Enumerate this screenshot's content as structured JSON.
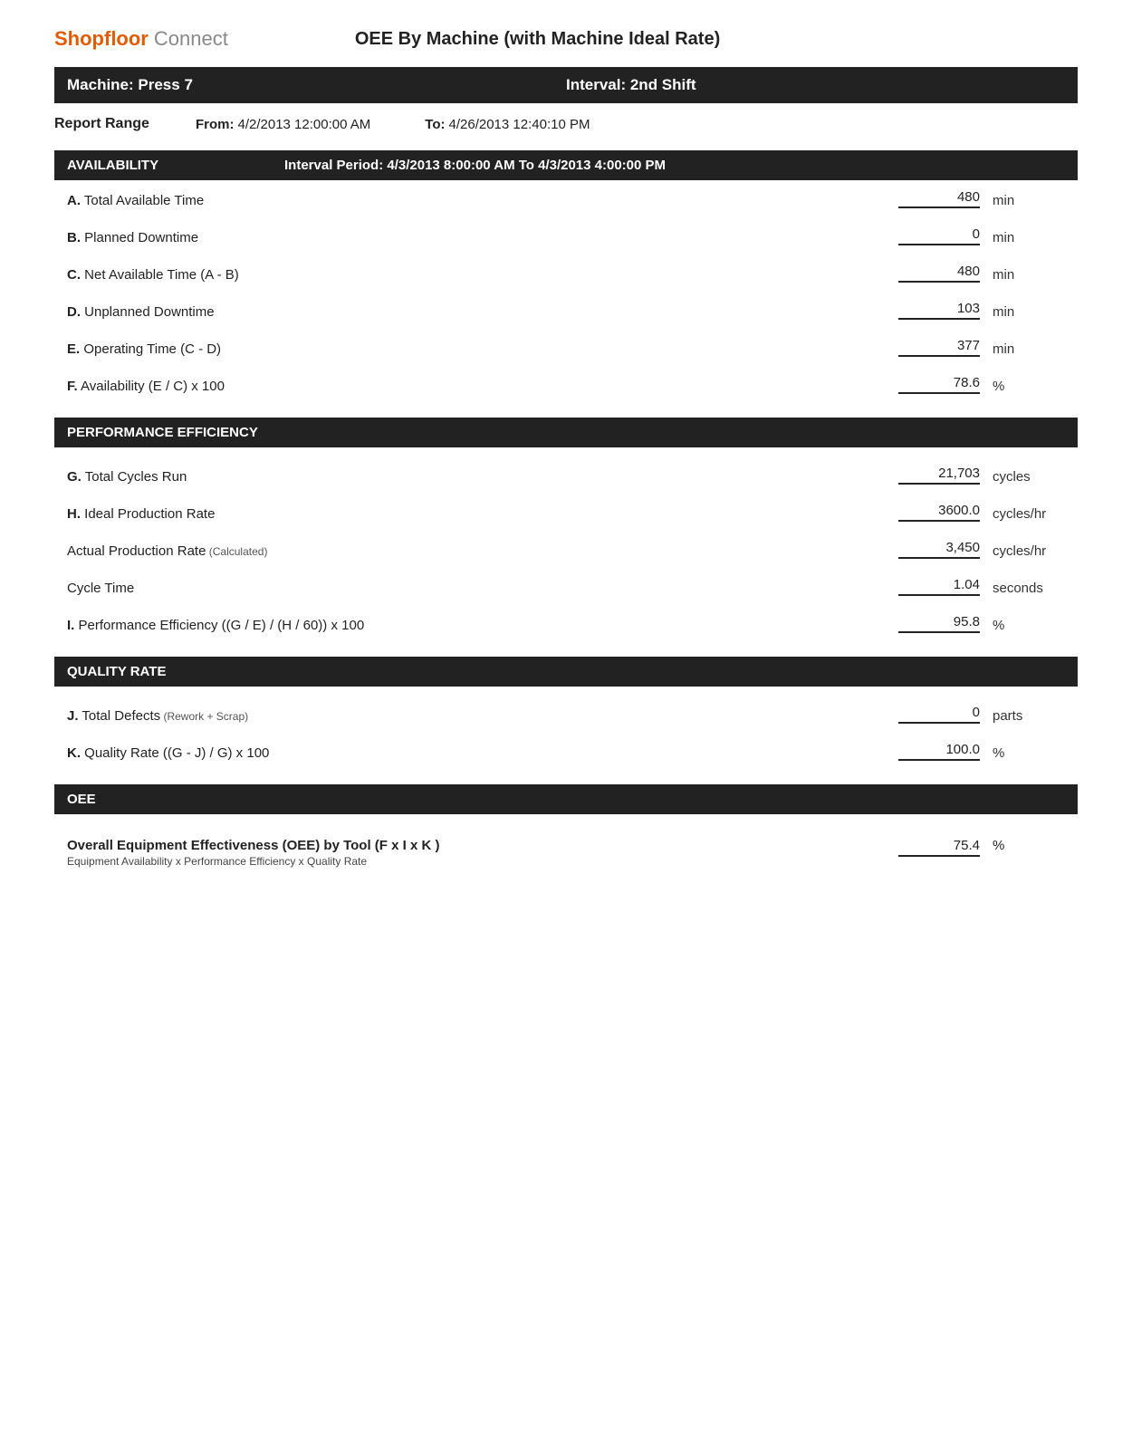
{
  "header": {
    "logo_shopfloor": "Shopfloor",
    "logo_connect": "Connect",
    "report_title": "OEE By Machine (with Machine Ideal Rate)"
  },
  "machine_bar": {
    "machine_label": "Machine:",
    "machine_name": "Press 7",
    "machine_full": "Machine: Press 7",
    "interval_label": "Interval:",
    "interval_value": "2nd Shift",
    "interval_full": "Interval: 2nd Shift"
  },
  "report_range": {
    "label": "Report Range",
    "from_label": "From:",
    "from_value": "4/2/2013 12:00:00 AM",
    "to_label": "To:",
    "to_value": "4/26/2013 12:40:10 PM"
  },
  "availability": {
    "section_title": "AVAILABILITY",
    "interval_period": "Interval Period: 4/3/2013 8:00:00 AM  To  4/3/2013 4:00:00 PM",
    "rows": [
      {
        "label_bold": "A.",
        "label_rest": " Total Available Time",
        "value": "480",
        "unit": "min"
      },
      {
        "label_bold": "B.",
        "label_rest": " Planned Downtime",
        "value": "0",
        "unit": "min"
      },
      {
        "label_bold": "C.",
        "label_rest": " Net Available Time (A - B)",
        "value": "480",
        "unit": "min"
      },
      {
        "label_bold": "D.",
        "label_rest": " Unplanned Downtime",
        "value": "103",
        "unit": "min"
      },
      {
        "label_bold": "E.",
        "label_rest": " Operating Time (C - D)",
        "value": "377",
        "unit": "min"
      },
      {
        "label_bold": "F.",
        "label_rest": " Availability (E / C) x 100",
        "value": "78.6",
        "unit": "%"
      }
    ]
  },
  "performance_efficiency": {
    "section_title": "PERFORMANCE EFFICIENCY",
    "rows": [
      {
        "label_bold": "G.",
        "label_rest": " Total Cycles Run",
        "value": "21,703",
        "unit": "cycles"
      },
      {
        "label_bold": "H.",
        "label_rest": " Ideal Production Rate",
        "value": "3600.0",
        "unit": "cycles/hr"
      },
      {
        "label_bold": "",
        "label_rest": "Actual Production Rate",
        "label_small": "(Calculated)",
        "value": "3,450",
        "unit": "cycles/hr"
      },
      {
        "label_bold": "",
        "label_rest": "Cycle Time",
        "value": "1.04",
        "unit": "seconds"
      },
      {
        "label_bold": "I.",
        "label_rest": " Performance Efficiency ((G / E) / (H / 60)) x 100",
        "value": "95.8",
        "unit": "%"
      }
    ]
  },
  "quality_rate": {
    "section_title": "QUALITY RATE",
    "rows": [
      {
        "label_bold": "J.",
        "label_rest": " Total Defects",
        "label_small": "(Rework + Scrap)",
        "value": "0",
        "unit": "parts"
      },
      {
        "label_bold": "K.",
        "label_rest": " Quality Rate ((G - J) / G) x 100",
        "value": "100.0",
        "unit": "%"
      }
    ]
  },
  "oee": {
    "section_title": "OEE",
    "label_main": "Overall Equipment Effectiveness (OEE) by Tool  (F x I x K )",
    "label_sub": "Equipment Availability x Performance Efficiency x Quality Rate",
    "value": "75.4",
    "unit": "%"
  }
}
